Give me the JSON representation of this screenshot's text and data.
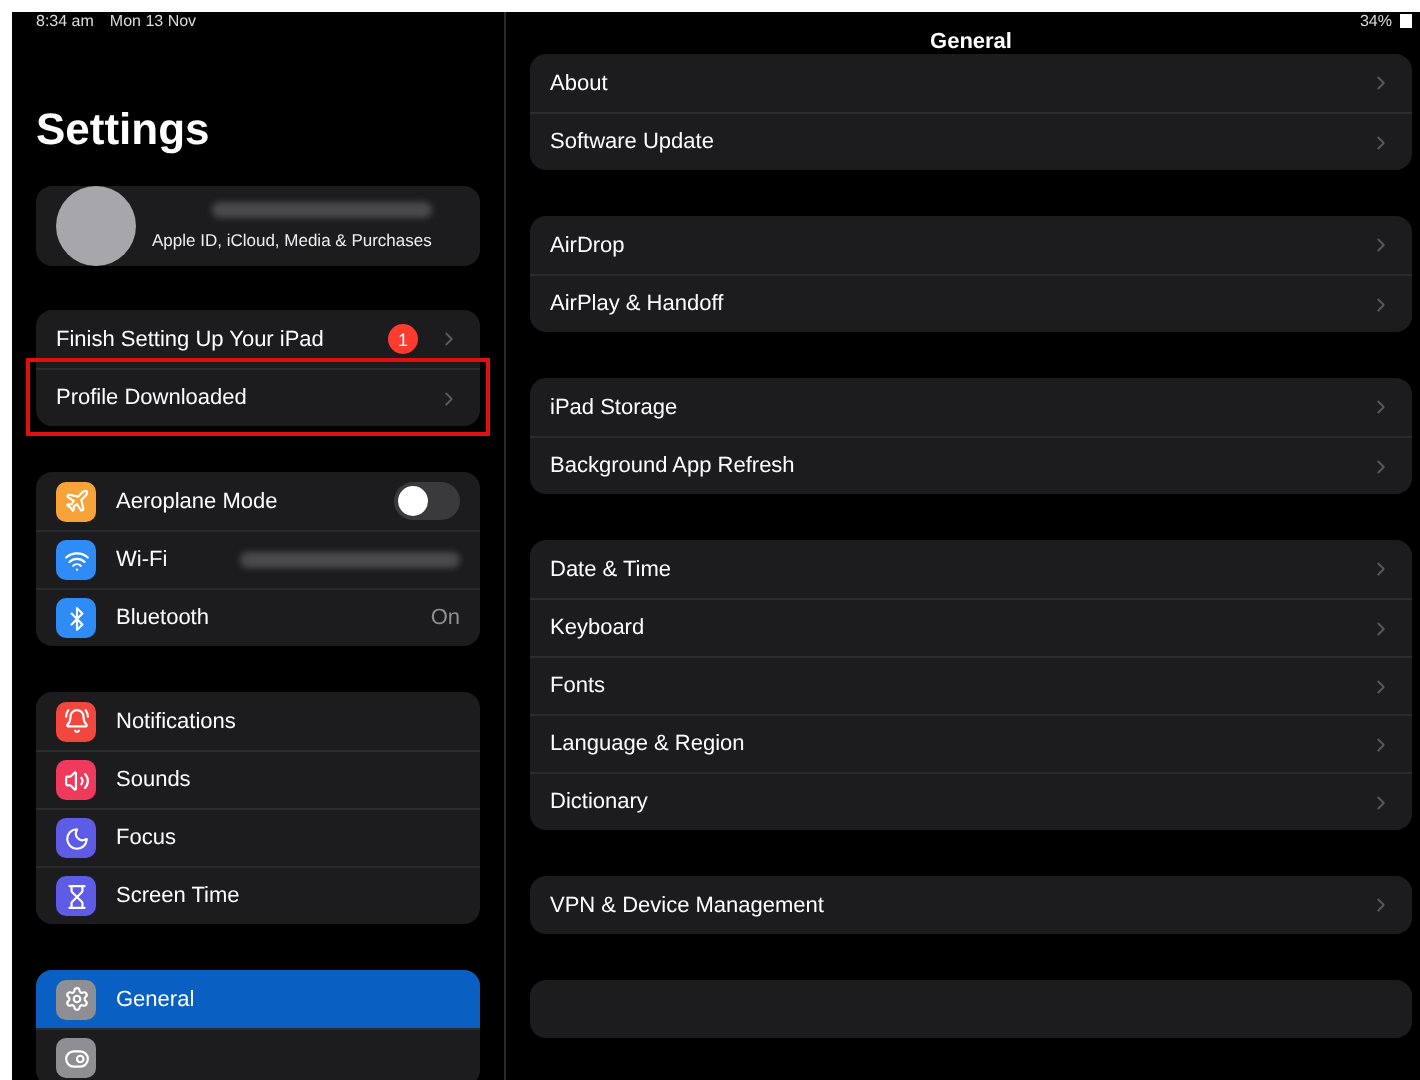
{
  "status_bar": {
    "time": "8:34 am",
    "date": "Mon 13 Nov",
    "battery": "34%"
  },
  "sidebar": {
    "title": "Settings",
    "account": {
      "subtitle": "Apple ID, iCloud, Media & Purchases"
    },
    "groups": [
      [
        {
          "label": "Finish Setting Up Your iPad",
          "kind": "badge",
          "badge": "1",
          "outlined": false,
          "selected": false
        },
        {
          "label": "Profile Downloaded",
          "kind": "plain",
          "outlined": true,
          "selected": false
        }
      ],
      [
        {
          "label": "Aeroplane Mode",
          "kind": "toggle",
          "on": false,
          "color": "#f7a33a",
          "selected": false
        },
        {
          "label": "Wi-Fi",
          "kind": "blurred",
          "color": "#2f8bf5",
          "selected": false
        },
        {
          "label": "Bluetooth",
          "kind": "value",
          "value": "On",
          "color": "#2f8bf5",
          "selected": false
        }
      ],
      [
        {
          "label": "Notifications",
          "kind": "plain",
          "color": "#f2473f",
          "selected": false
        },
        {
          "label": "Sounds",
          "kind": "plain",
          "color": "#ef3a5d",
          "selected": false
        },
        {
          "label": "Focus",
          "kind": "plain",
          "color": "#5e5ce6",
          "selected": false
        },
        {
          "label": "Screen Time",
          "kind": "plain",
          "color": "#5e5ce6",
          "selected": false
        }
      ],
      [
        {
          "label": "General",
          "kind": "plain",
          "color": "#8e8e93",
          "selected": true
        },
        {
          "kind": "cut",
          "color": "#8e8e93",
          "selected": false
        }
      ]
    ]
  },
  "main": {
    "title": "General",
    "groups": [
      [
        {
          "label": "About"
        },
        {
          "label": "Software Update"
        }
      ],
      [
        {
          "label": "AirDrop"
        },
        {
          "label": "AirPlay & Handoff"
        }
      ],
      [
        {
          "label": "iPad Storage"
        },
        {
          "label": "Background App Refresh"
        }
      ],
      [
        {
          "label": "Date & Time"
        },
        {
          "label": "Keyboard"
        },
        {
          "label": "Fonts"
        },
        {
          "label": "Language & Region"
        },
        {
          "label": "Dictionary"
        }
      ],
      [
        {
          "label": "VPN & Device Management"
        }
      ],
      [
        {
          "kind": "cut"
        }
      ]
    ]
  }
}
